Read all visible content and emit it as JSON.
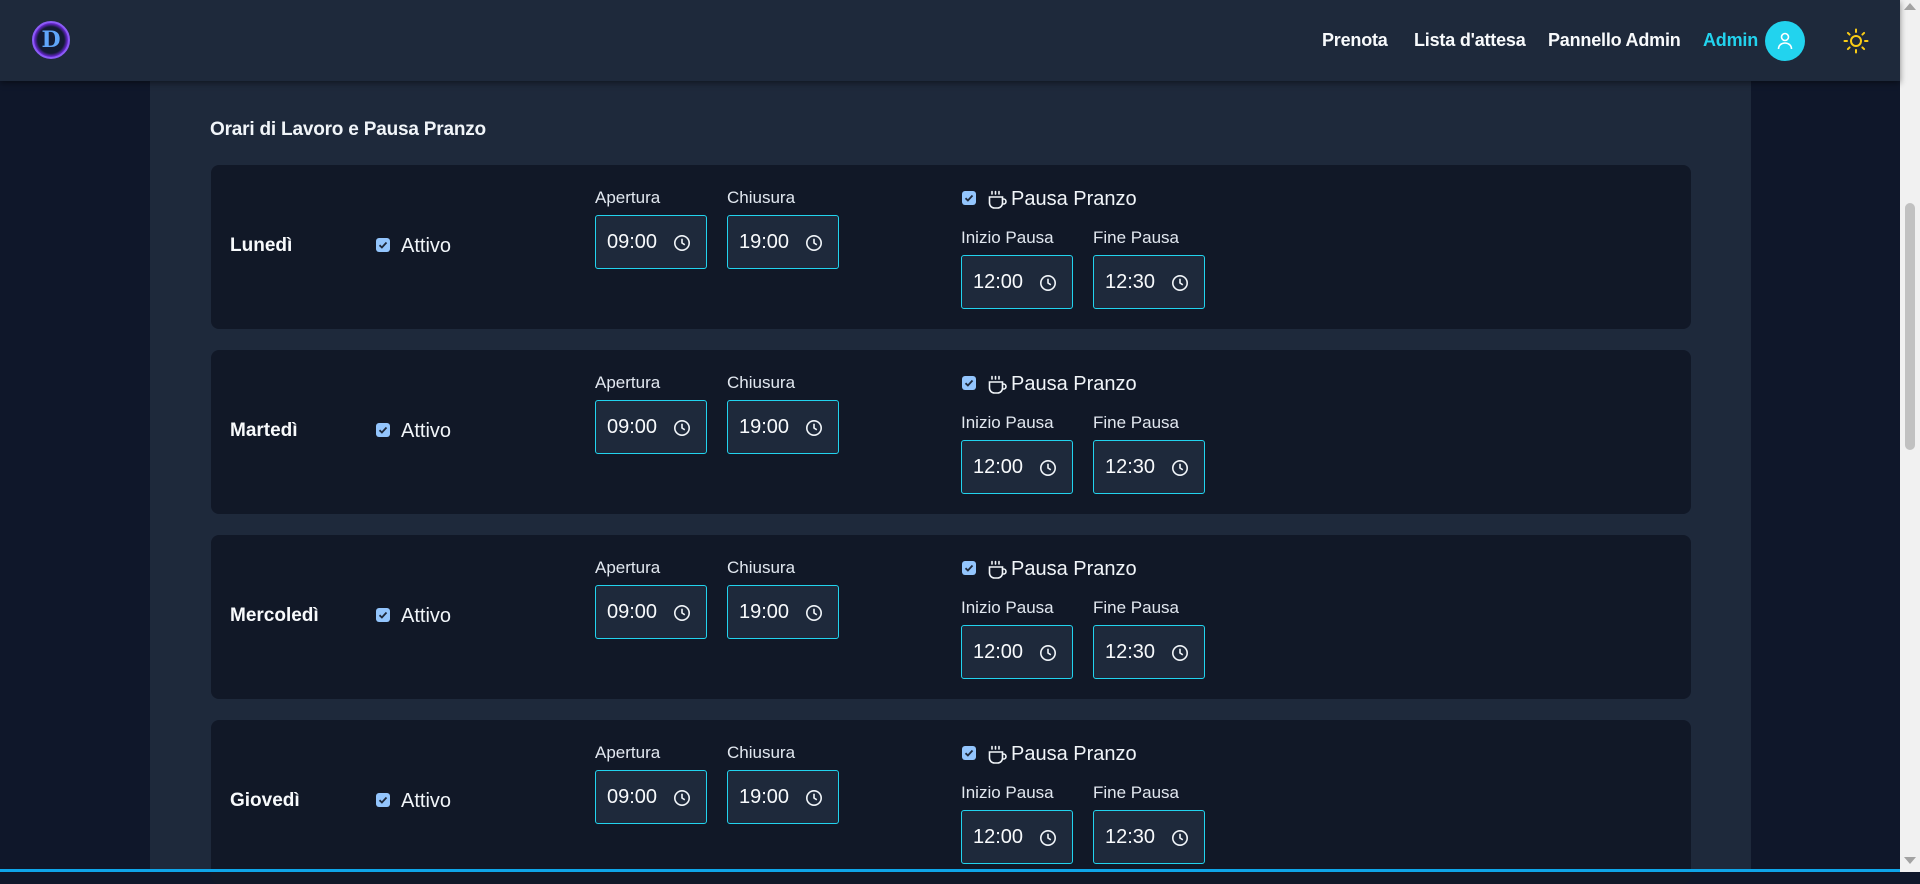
{
  "header": {
    "logo_letter": "D",
    "nav": {
      "book": "Prenota",
      "waitlist": "Lista d'attesa",
      "admin_panel": "Pannello Admin",
      "user": "Admin"
    }
  },
  "section": {
    "title": "Orari di Lavoro e Pausa Pranzo"
  },
  "labels": {
    "active": "Attivo",
    "open": "Apertura",
    "close": "Chiusura",
    "lunch": "Pausa Pranzo",
    "break_start": "Inizio Pausa",
    "break_end": "Fine Pausa"
  },
  "days": [
    {
      "name": "Lunedì",
      "active": true,
      "open": "09:00",
      "close": "19:00",
      "lunch": true,
      "break_start": "12:00",
      "break_end": "12:30"
    },
    {
      "name": "Martedì",
      "active": true,
      "open": "09:00",
      "close": "19:00",
      "lunch": true,
      "break_start": "12:00",
      "break_end": "12:30"
    },
    {
      "name": "Mercoledì",
      "active": true,
      "open": "09:00",
      "close": "19:00",
      "lunch": true,
      "break_start": "12:00",
      "break_end": "12:30"
    },
    {
      "name": "Giovedì",
      "active": true,
      "open": "09:00",
      "close": "19:00",
      "lunch": true,
      "break_start": "12:00",
      "break_end": "12:30"
    }
  ],
  "colors": {
    "accent": "#22d3ee",
    "background": "#0f172a",
    "panel": "#1e293b",
    "card": "#111827",
    "sun": "#facc15"
  }
}
